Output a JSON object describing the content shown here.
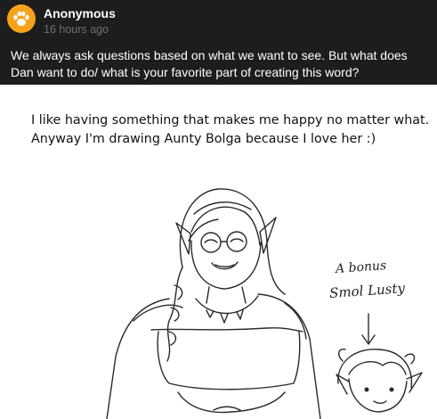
{
  "ask": {
    "asker_name": "Anonymous",
    "time_ago": "16 hours ago",
    "question": "We always ask questions based on what we want to see. But what does Dan want to do/ what is your favorite part of creating this word?",
    "avatar_icon": "paw-print-icon",
    "avatar_color": "#f7a21b"
  },
  "answer": {
    "line1": "I like having something that makes me happy no matter what.",
    "line2": "Anyway I'm drawing Aunty Bolga because I love her :)"
  },
  "drawing_notes": {
    "line1": "A bonus",
    "line2": "Smol Lusty"
  }
}
